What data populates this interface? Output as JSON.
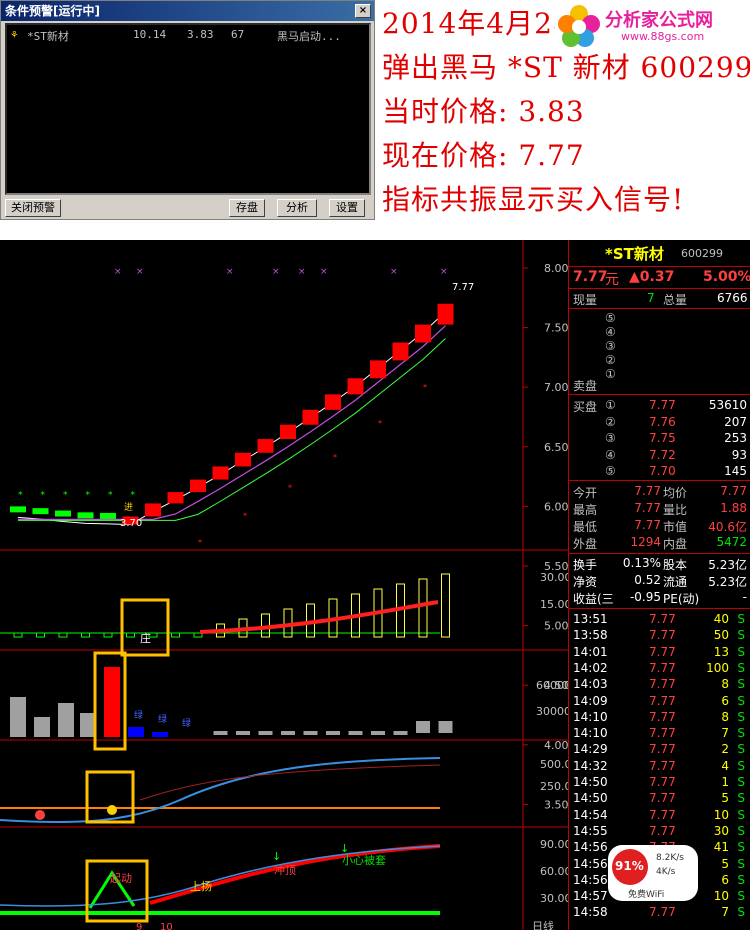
{
  "alert_window": {
    "title": "条件预警[运行中]",
    "close": "×",
    "row": {
      "icon": "⚘",
      "name": "*ST新材",
      "v1": "10.14",
      "v2": "3.83",
      "v3": "67",
      "msg": "黑马启动..."
    },
    "buttons": {
      "close_alert": "关闭预警",
      "save": "存盘",
      "analyze": "分析",
      "settings": "设置"
    }
  },
  "headline": {
    "line1": "2014年4月28",
    "line2": "弹出黑马 *ST 新材 600299",
    "line3": "当时价格: 3.83",
    "line4": "现在价格: 7.77",
    "line5": "指标共振显示买入信号!"
  },
  "logo": {
    "text": "分析家公式网",
    "url": "www.88gs.com"
  },
  "chart": {
    "price_labels": {
      "last": "7.77",
      "low": "3.70",
      "jin": "进"
    },
    "price_axis": [
      "8.00",
      "7.50",
      "7.00",
      "6.50",
      "6.00",
      "5.50",
      "5.00",
      "4.50",
      "4.00",
      "3.50"
    ],
    "ind1_axis": [
      "30.00",
      "15.00"
    ],
    "ind1_label": "庄",
    "vol_axis": [
      "60000",
      "30000"
    ],
    "vol_marks": [
      "绿",
      "绿",
      "绿"
    ],
    "ind3_axis": [
      "500.0",
      "250.0"
    ],
    "ind4_axis": [
      "90.00",
      "60.00",
      "30.00"
    ],
    "ind4_labels": {
      "qidong": "起动",
      "shangyang": "上扬",
      "chongding": "冲顶",
      "xiaoxin": "小心被套"
    },
    "x_labels": [
      "9",
      "10"
    ],
    "period": "日线",
    "colors": {
      "up": "#ff0000",
      "down": "#00ff00",
      "ma1": "#ffffff",
      "ma2": "#c050e0",
      "ma3": "#40ff40",
      "box": "#ffc000"
    }
  },
  "quote": {
    "name": "*ST新材",
    "code": "600299",
    "price": "7.77",
    "unit": "元",
    "change": "▲0.37",
    "pct": "5.00%",
    "xianliang_label": "现量",
    "xianliang": "7",
    "zongliang_label": "总量",
    "zongliang": "6766",
    "sell_label": "卖盘",
    "sell_levels": [
      "⑤",
      "④",
      "③",
      "②",
      "①"
    ],
    "buy_label": "买盘",
    "bids": [
      {
        "lv": "①",
        "p": "7.77",
        "v": "53610"
      },
      {
        "lv": "②",
        "p": "7.76",
        "v": "207"
      },
      {
        "lv": "③",
        "p": "7.75",
        "v": "253"
      },
      {
        "lv": "④",
        "p": "7.72",
        "v": "93"
      },
      {
        "lv": "⑤",
        "p": "7.70",
        "v": "145"
      }
    ],
    "stats": [
      [
        "今开",
        "7.77",
        "均价",
        "7.77"
      ],
      [
        "最高",
        "7.77",
        "量比",
        "1.88"
      ],
      [
        "最低",
        "7.77",
        "市值",
        "40.6亿"
      ],
      [
        "外盘",
        "1294",
        "内盘",
        "5472"
      ]
    ],
    "stats2": [
      [
        "换手",
        "0.13%",
        "股本",
        "5.23亿"
      ],
      [
        "净资",
        "0.52",
        "流通",
        "5.23亿"
      ],
      [
        "收益(三",
        "-0.95",
        "PE(动)",
        "-"
      ]
    ],
    "ticks": [
      [
        "13:51",
        "7.77",
        "40",
        "S"
      ],
      [
        "13:58",
        "7.77",
        "50",
        "S"
      ],
      [
        "14:01",
        "7.77",
        "13",
        "S"
      ],
      [
        "14:02",
        "7.77",
        "100",
        "S"
      ],
      [
        "14:03",
        "7.77",
        "8",
        "S"
      ],
      [
        "14:09",
        "7.77",
        "6",
        "S"
      ],
      [
        "14:10",
        "7.77",
        "8",
        "S"
      ],
      [
        "14:10",
        "7.77",
        "7",
        "S"
      ],
      [
        "14:29",
        "7.77",
        "2",
        "S"
      ],
      [
        "14:32",
        "7.77",
        "4",
        "S"
      ],
      [
        "14:50",
        "7.77",
        "1",
        "S"
      ],
      [
        "14:50",
        "7.77",
        "5",
        "S"
      ],
      [
        "14:54",
        "7.77",
        "10",
        "S"
      ],
      [
        "14:55",
        "7.77",
        "30",
        "S"
      ],
      [
        "14:56",
        "7.77",
        "41",
        "S"
      ],
      [
        "14:56",
        "7.77",
        "5",
        "S"
      ],
      [
        "14:56",
        "7.77",
        "6",
        "S"
      ],
      [
        "14:57",
        "7.77",
        "10",
        "S"
      ],
      [
        "14:58",
        "7.77",
        "7",
        "S"
      ]
    ]
  },
  "wifi": {
    "pct": "91%",
    "up": "8.2K/s",
    "down": "4K/s",
    "label": "免费WiFi"
  }
}
